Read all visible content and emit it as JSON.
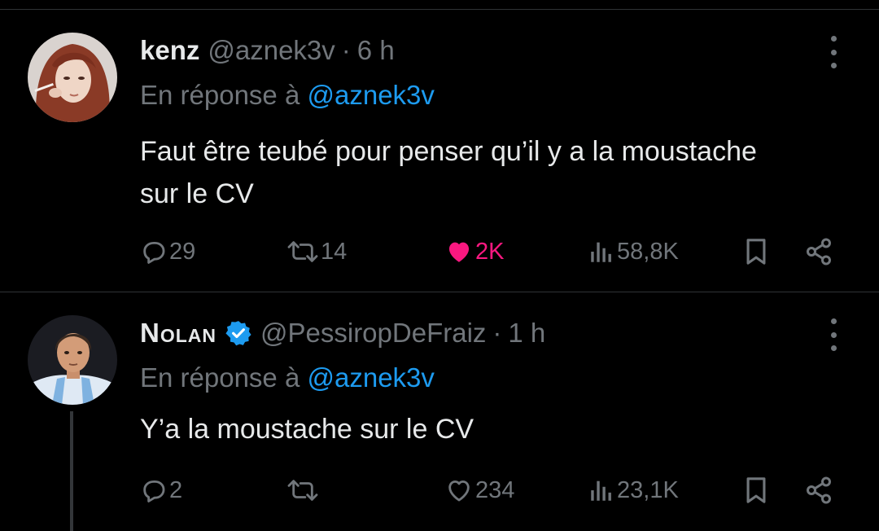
{
  "tweets": [
    {
      "display_name": "kenz",
      "handle": "@aznek3v",
      "separator": "·",
      "time": "6 h",
      "reply_prefix": "En réponse à",
      "reply_to": "@aznek3v",
      "text": "Faut être teubé pour penser qu’il y a la moustache sur le CV",
      "actions": {
        "replies": "29",
        "retweets": "14",
        "likes": "2K",
        "liked": true,
        "views": "58,8K"
      }
    },
    {
      "display_name": "Nolan",
      "verified": true,
      "handle": "@PessiropDeFraiz",
      "separator": "·",
      "time": "1 h",
      "reply_prefix": "En réponse à",
      "reply_to": "@aznek3v",
      "text": "Y’a la moustache sur le CV",
      "actions": {
        "replies": "2",
        "retweets": "",
        "likes": "234",
        "liked": false,
        "views": "23,1K"
      }
    }
  ],
  "colors": {
    "background": "#000000",
    "text_primary": "#e7e9ea",
    "text_secondary": "#71767b",
    "link": "#1d9bf0",
    "like_active": "#f91880",
    "verified": "#1d9bf0"
  },
  "icons": [
    "reply-icon",
    "retweet-icon",
    "like-icon",
    "views-icon",
    "bookmark-icon",
    "share-icon",
    "more-icon",
    "verified-badge-icon"
  ]
}
